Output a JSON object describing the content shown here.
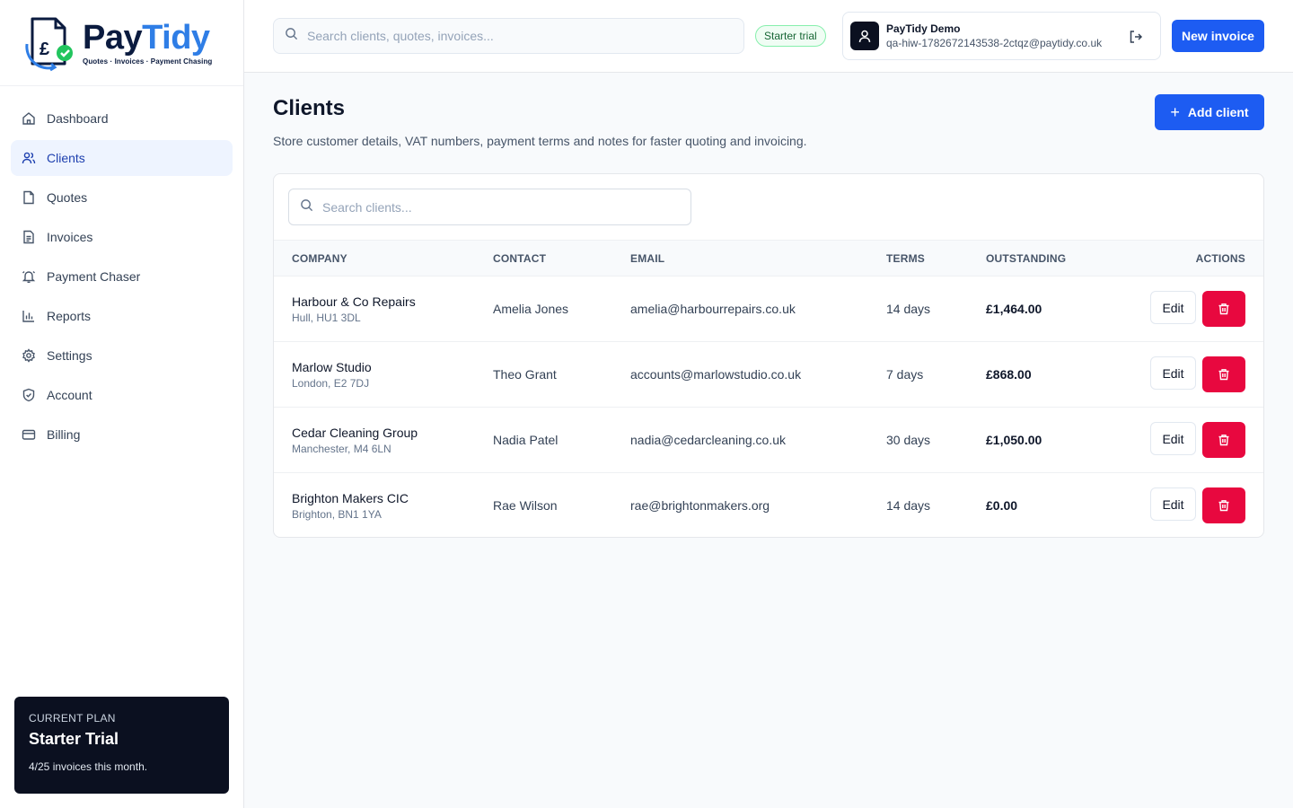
{
  "brand": {
    "word_part1": "Pay",
    "word_part2": "Tidy",
    "tagline": "Quotes · Invoices · Payment Chasing",
    "colors": {
      "navy": "#0b1b3f",
      "blue": "#2f7ee6",
      "green": "#22c55e"
    }
  },
  "sidebar": {
    "items": [
      {
        "label": "Dashboard",
        "icon": "home-icon"
      },
      {
        "label": "Clients",
        "icon": "users-icon",
        "active": true
      },
      {
        "label": "Quotes",
        "icon": "file-icon"
      },
      {
        "label": "Invoices",
        "icon": "file-text-icon"
      },
      {
        "label": "Payment Chaser",
        "icon": "bell-icon"
      },
      {
        "label": "Reports",
        "icon": "bar-chart-icon"
      },
      {
        "label": "Settings",
        "icon": "gear-icon"
      },
      {
        "label": "Account",
        "icon": "shield-icon"
      },
      {
        "label": "Billing",
        "icon": "credit-card-icon"
      }
    ],
    "plan": {
      "eyebrow": "CURRENT PLAN",
      "name": "Starter Trial",
      "usage": "4/25 invoices this month."
    }
  },
  "topbar": {
    "search_placeholder": "Search clients, quotes, invoices...",
    "trial_badge": "Starter trial",
    "user_name": "PayTidy Demo",
    "user_email": "qa-hiw-1782672143538-2ctqz@paytidy.co.uk",
    "new_invoice_label": "New invoice"
  },
  "page": {
    "title": "Clients",
    "subtitle": "Store customer details, VAT numbers, payment terms and notes for faster quoting and invoicing.",
    "add_client_label": "Add client",
    "table_search_placeholder": "Search clients..."
  },
  "table": {
    "headers": {
      "company": "COMPANY",
      "contact": "CONTACT",
      "email": "EMAIL",
      "terms": "TERMS",
      "outstanding": "OUTSTANDING",
      "actions": "ACTIONS"
    },
    "edit_label": "Edit",
    "rows": [
      {
        "company": "Harbour & Co Repairs",
        "location": "Hull, HU1 3DL",
        "contact": "Amelia Jones",
        "email": "amelia@harbourrepairs.co.uk",
        "terms": "14 days",
        "outstanding": "£1,464.00"
      },
      {
        "company": "Marlow Studio",
        "location": "London, E2 7DJ",
        "contact": "Theo Grant",
        "email": "accounts@marlowstudio.co.uk",
        "terms": "7 days",
        "outstanding": "£868.00"
      },
      {
        "company": "Cedar Cleaning Group",
        "location": "Manchester, M4 6LN",
        "contact": "Nadia Patel",
        "email": "nadia@cedarcleaning.co.uk",
        "terms": "30 days",
        "outstanding": "£1,050.00"
      },
      {
        "company": "Brighton Makers CIC",
        "location": "Brighton, BN1 1YA",
        "contact": "Rae Wilson",
        "email": "rae@brightonmakers.org",
        "terms": "14 days",
        "outstanding": "£0.00"
      }
    ]
  },
  "colors": {
    "primary": "#1d5cf2",
    "danger": "#e8083f",
    "active_nav_bg": "#eef4ff",
    "plan_card_bg": "#0b1020"
  }
}
